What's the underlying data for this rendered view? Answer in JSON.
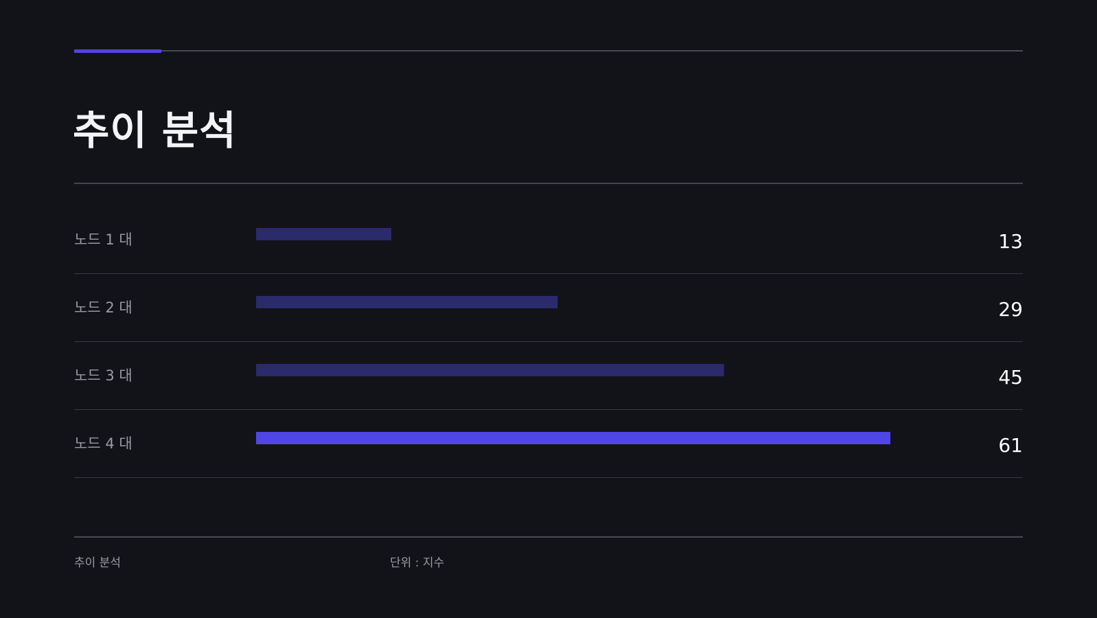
{
  "header": {
    "title": "추이 분석"
  },
  "colors": {
    "background": "#121319",
    "accent": "#4f46e5",
    "bar_muted": "#2b2a6b",
    "label": "#9a9ba3",
    "value": "#ffffff",
    "rule": "#3a3b42"
  },
  "chart_data": {
    "type": "bar",
    "orientation": "horizontal",
    "categories": [
      "노드 1 대",
      "노드 2 대",
      "노드 3 대",
      "노드 4 대"
    ],
    "values": [
      13,
      29,
      45,
      61
    ],
    "value_labels": [
      "13",
      "29",
      "45",
      "61"
    ],
    "highlight_index": 3,
    "xlim": [
      0,
      66
    ],
    "grid": false
  },
  "footer": {
    "source": "추이 분석",
    "unit": "단위 : 지수"
  }
}
